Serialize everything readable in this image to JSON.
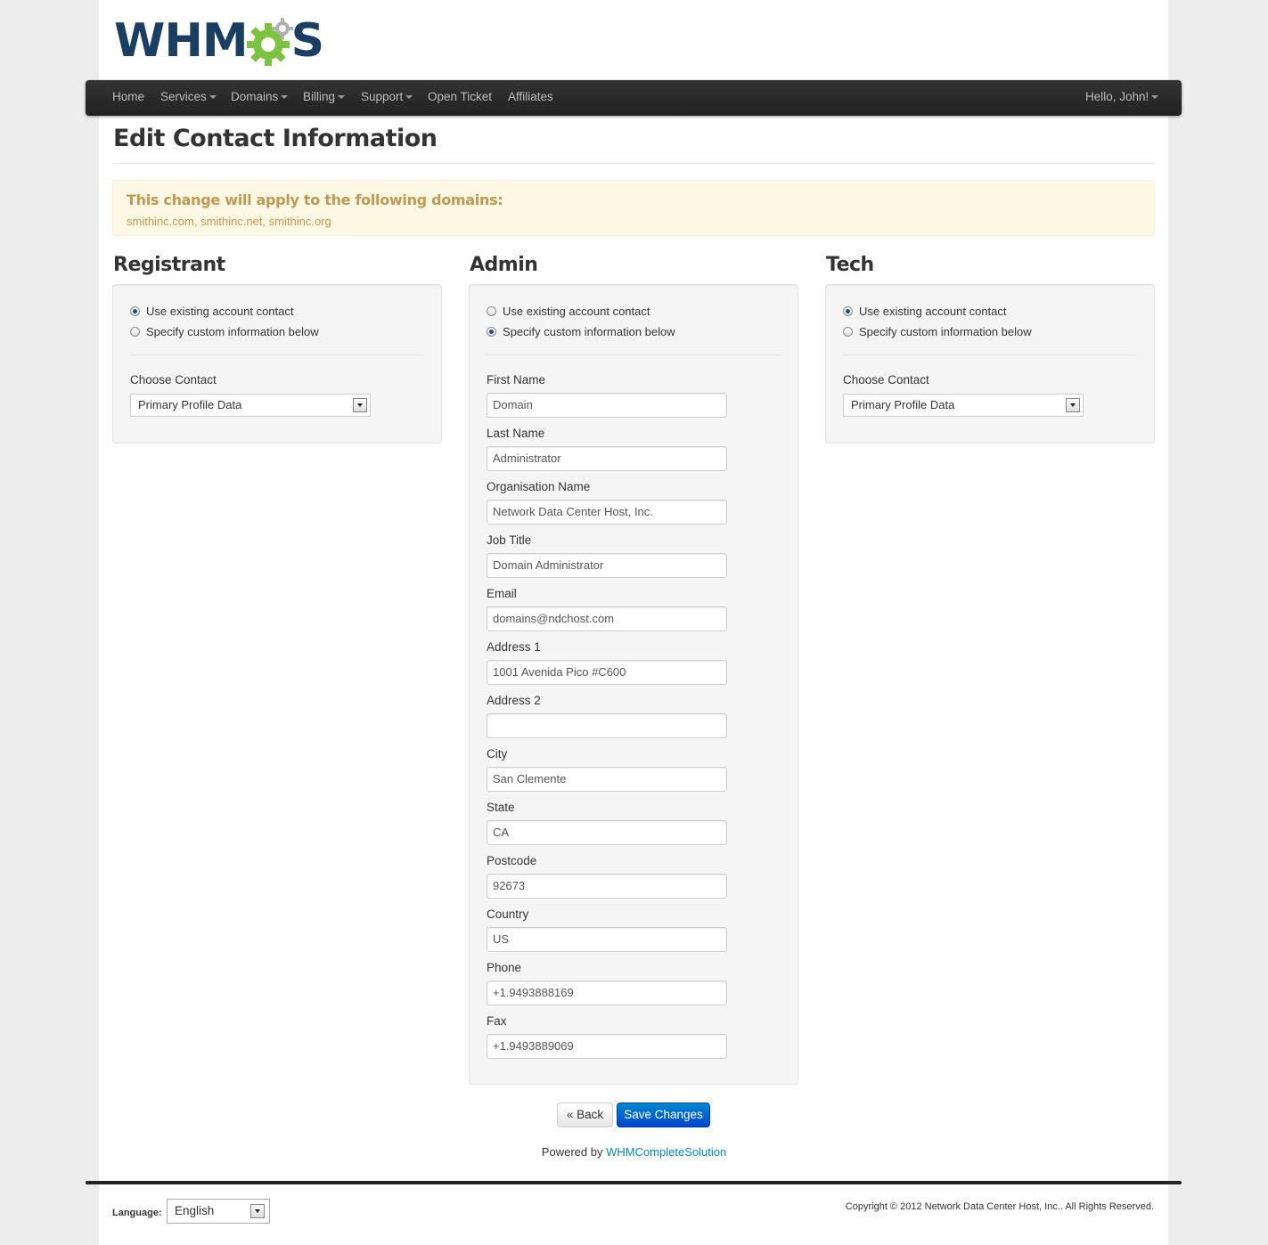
{
  "brand": {
    "logo_text_left": "WHM",
    "logo_text_right": "S"
  },
  "nav": {
    "home": "Home",
    "services": "Services",
    "domains": "Domains",
    "billing": "Billing",
    "support": "Support",
    "open_ticket": "Open Ticket",
    "affiliates": "Affiliates",
    "user": "Hello, John!"
  },
  "page_title": "Edit Contact Information",
  "alert": {
    "heading": "This change will apply to the following domains:",
    "domains": "smithinc.com, smithinc.net, smithinc.org"
  },
  "registrant": {
    "title": "Registrant",
    "option_existing": "Use existing account contact",
    "option_custom": "Specify custom information below",
    "choose_label": "Choose Contact",
    "contact_value": "Primary Profile Data"
  },
  "admin": {
    "title": "Admin",
    "option_existing": "Use existing account contact",
    "option_custom": "Specify custom information below",
    "fields": [
      {
        "label": "First Name",
        "value": "Domain"
      },
      {
        "label": "Last Name",
        "value": "Administrator"
      },
      {
        "label": "Organisation Name",
        "value": "Network Data Center Host, Inc."
      },
      {
        "label": "Job Title",
        "value": "Domain Administrator"
      },
      {
        "label": "Email",
        "value": "domains@ndchost.com"
      },
      {
        "label": "Address 1",
        "value": "1001 Avenida Pico #C600"
      },
      {
        "label": "Address 2",
        "value": ""
      },
      {
        "label": "City",
        "value": "San Clemente"
      },
      {
        "label": "State",
        "value": "CA"
      },
      {
        "label": "Postcode",
        "value": "92673"
      },
      {
        "label": "Country",
        "value": "US"
      },
      {
        "label": "Phone",
        "value": "+1.9493888169"
      },
      {
        "label": "Fax",
        "value": "+1.9493889069"
      }
    ]
  },
  "tech": {
    "title": "Tech",
    "option_existing": "Use existing account contact",
    "option_custom": "Specify custom information below",
    "choose_label": "Choose Contact",
    "contact_value": "Primary Profile Data"
  },
  "buttons": {
    "back": "« Back",
    "save": "Save Changes"
  },
  "powered": {
    "prefix": "Powered by",
    "link": "WHMCompleteSolution"
  },
  "footer": {
    "language_label": "Language:",
    "language_value": "English",
    "copyright": "Copyright © 2012 Network Data Center Host, Inc.. All Rights Reserved."
  },
  "colors": {
    "accent": "#0088cc",
    "navbar": "#222222",
    "alert_text": "#c09853",
    "logo_dark": "#1b3f63",
    "logo_green": "#7dc242"
  }
}
